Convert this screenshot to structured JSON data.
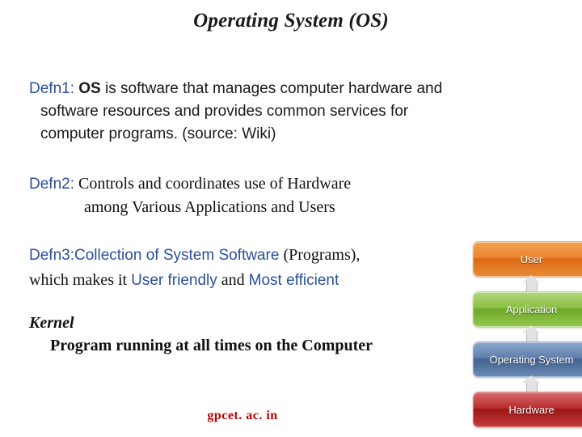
{
  "slide": {
    "title": "Operating System (OS)",
    "defn1": {
      "label": "Defn1:",
      "emphasis": "OS",
      "line1_rest": " is software that manages computer hardware and",
      "line2": "software  resources  and  provides  common  services  for",
      "line3": "computer programs. (source: Wiki)"
    },
    "defn2": {
      "label": "Defn2:",
      "line1": " Controls and coordinates use of Hardware",
      "line2": "among Various Applications and Users"
    },
    "defn3": {
      "label": "Defn3:",
      "part1_blue": "Collection of System Software",
      "part2": " (Programs),",
      "line2_a": "which makes it ",
      "line2_blue1": "User friendly",
      "line2_b": " and ",
      "line2_blue2": "Most efficient"
    },
    "kernel": {
      "title": "Kernel",
      "body": "Program running at all times on the Computer"
    },
    "footer": "gpcet. ac. in",
    "stack": {
      "layers": [
        {
          "label": "User",
          "color": "#e2801f"
        },
        {
          "label": "Application",
          "color": "#82b93a"
        },
        {
          "label": "Operating System",
          "color": "#52739f"
        },
        {
          "label": "Hardware",
          "color": "#b22525"
        }
      ]
    }
  }
}
